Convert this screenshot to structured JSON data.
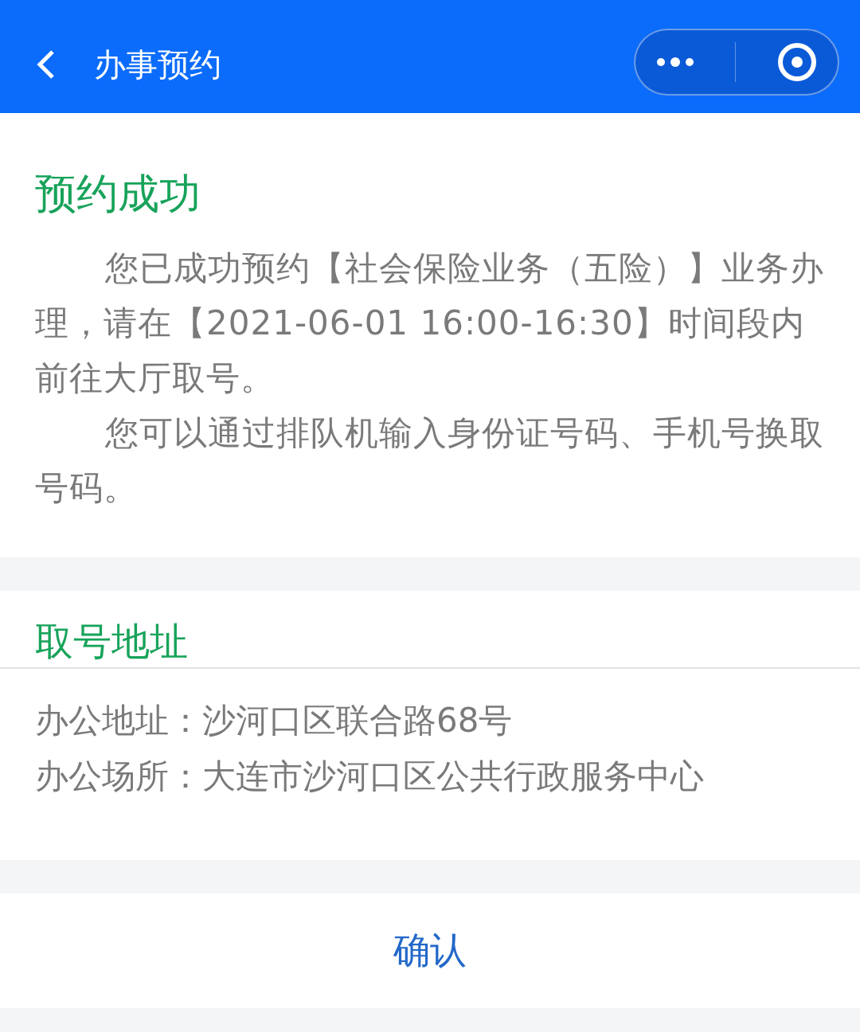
{
  "header": {
    "title": "办事预约"
  },
  "result": {
    "title": "预约成功",
    "paragraphs": [
      "您已成功预约【社会保险业务（五险）】业务办理，请在【2021-06-01 16:00-16:30】时间段内前往大厅取号。",
      "您可以通过排队机输入身份证号码、手机号换取号码。"
    ]
  },
  "address": {
    "title": "取号地址",
    "lines": [
      "办公地址：沙河口区联合路68号",
      "办公场所：大连市沙河口区公共行政服务中心"
    ]
  },
  "confirm_button": "确认"
}
